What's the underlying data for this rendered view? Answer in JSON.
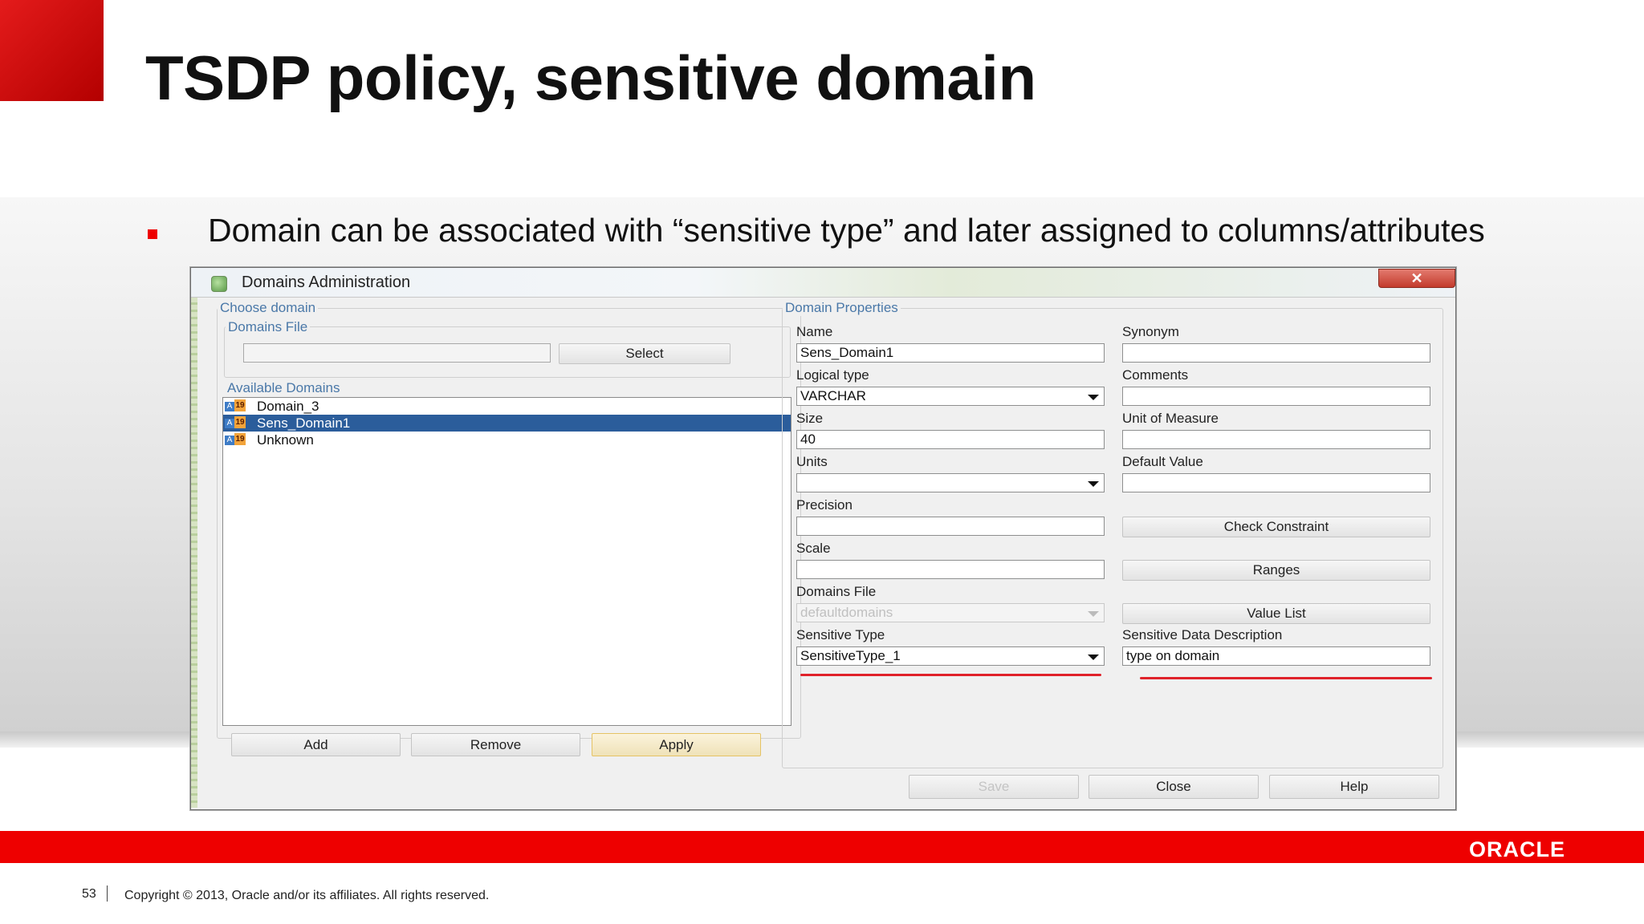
{
  "slide": {
    "title": "TSDP policy, sensitive domain",
    "bullet": "Domain can be associated with “sensitive type” and later assigned to columns/attributes"
  },
  "dialog": {
    "title": "Domains Administration",
    "close_label": "✕",
    "choose_domain": {
      "legend": "Choose domain",
      "domains_file_legend": "Domains File",
      "domains_file_value": "",
      "select_button": "Select",
      "available_domains_legend": "Available Domains",
      "domains": [
        {
          "label": "Domain_3",
          "selected": false
        },
        {
          "label": "Sens_Domain1",
          "selected": true
        },
        {
          "label": "Unknown",
          "selected": false
        }
      ],
      "add_button": "Add",
      "remove_button": "Remove",
      "apply_button": "Apply"
    },
    "properties": {
      "legend": "Domain Properties",
      "name_label": "Name",
      "name_value": "Sens_Domain1",
      "logical_type_label": "Logical type",
      "logical_type_value": "VARCHAR",
      "size_label": "Size",
      "size_value": "40",
      "units_label": "Units",
      "units_value": "",
      "precision_label": "Precision",
      "precision_value": "",
      "scale_label": "Scale",
      "scale_value": "",
      "domains_file_label": "Domains File",
      "domains_file_value": "defaultdomains",
      "sensitive_type_label": "Sensitive Type",
      "sensitive_type_value": "SensitiveType_1",
      "synonym_label": "Synonym",
      "synonym_value": "",
      "comments_label": "Comments",
      "comments_value": "",
      "unit_of_measure_label": "Unit of Measure",
      "unit_of_measure_value": "",
      "default_value_label": "Default Value",
      "default_value_value": "",
      "check_constraint_button": "Check Constraint",
      "ranges_button": "Ranges",
      "value_list_button": "Value List",
      "sensitive_desc_label": "Sensitive Data Description",
      "sensitive_desc_value": "type on domain"
    },
    "footer": {
      "save_button": "Save",
      "close_button": "Close",
      "help_button": "Help"
    }
  },
  "footer": {
    "page_number": "53",
    "copyright": "Copyright © 2013, Oracle and/or its affiliates. All rights reserved.",
    "logo": "ORACLE"
  },
  "colors": {
    "accent_red": "#ee0000",
    "selection_blue": "#2b5d9b",
    "legend_blue": "#4a78a8"
  }
}
